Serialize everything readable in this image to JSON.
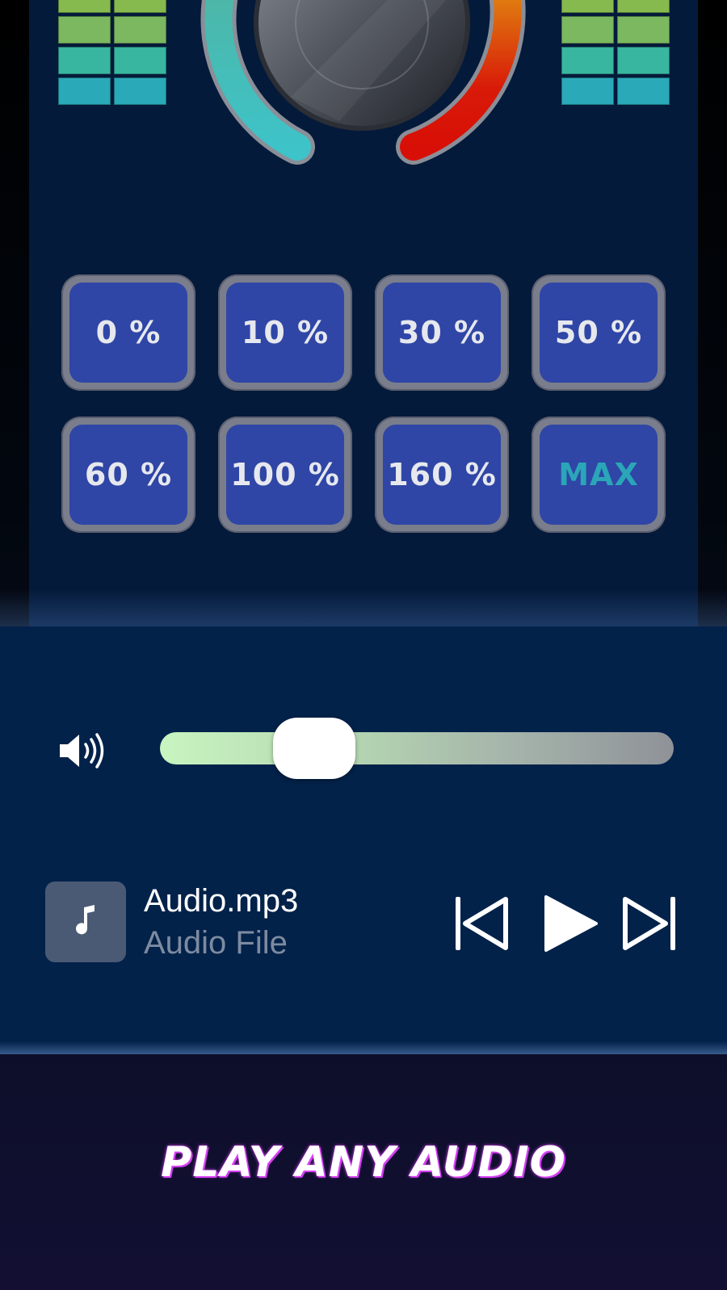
{
  "meters": {
    "colors": [
      "#86b94e",
      "#7bb860",
      "#38b6a0",
      "#2aa9b8"
    ]
  },
  "knob": {
    "left_arc_color": "#3ec3c9",
    "right_arc_color": "#d80f06"
  },
  "presets": [
    {
      "label": "0 %"
    },
    {
      "label": "10 %"
    },
    {
      "label": "30 %"
    },
    {
      "label": "50 %"
    },
    {
      "label": "60 %"
    },
    {
      "label": "100 %"
    },
    {
      "label": "160 %"
    },
    {
      "label": "MAX"
    }
  ],
  "player": {
    "volume_level": 0.3,
    "track_title": "Audio.mp3",
    "track_subtitle": "Audio File"
  },
  "promo": {
    "text": "PLAY ANY AUDIO"
  }
}
